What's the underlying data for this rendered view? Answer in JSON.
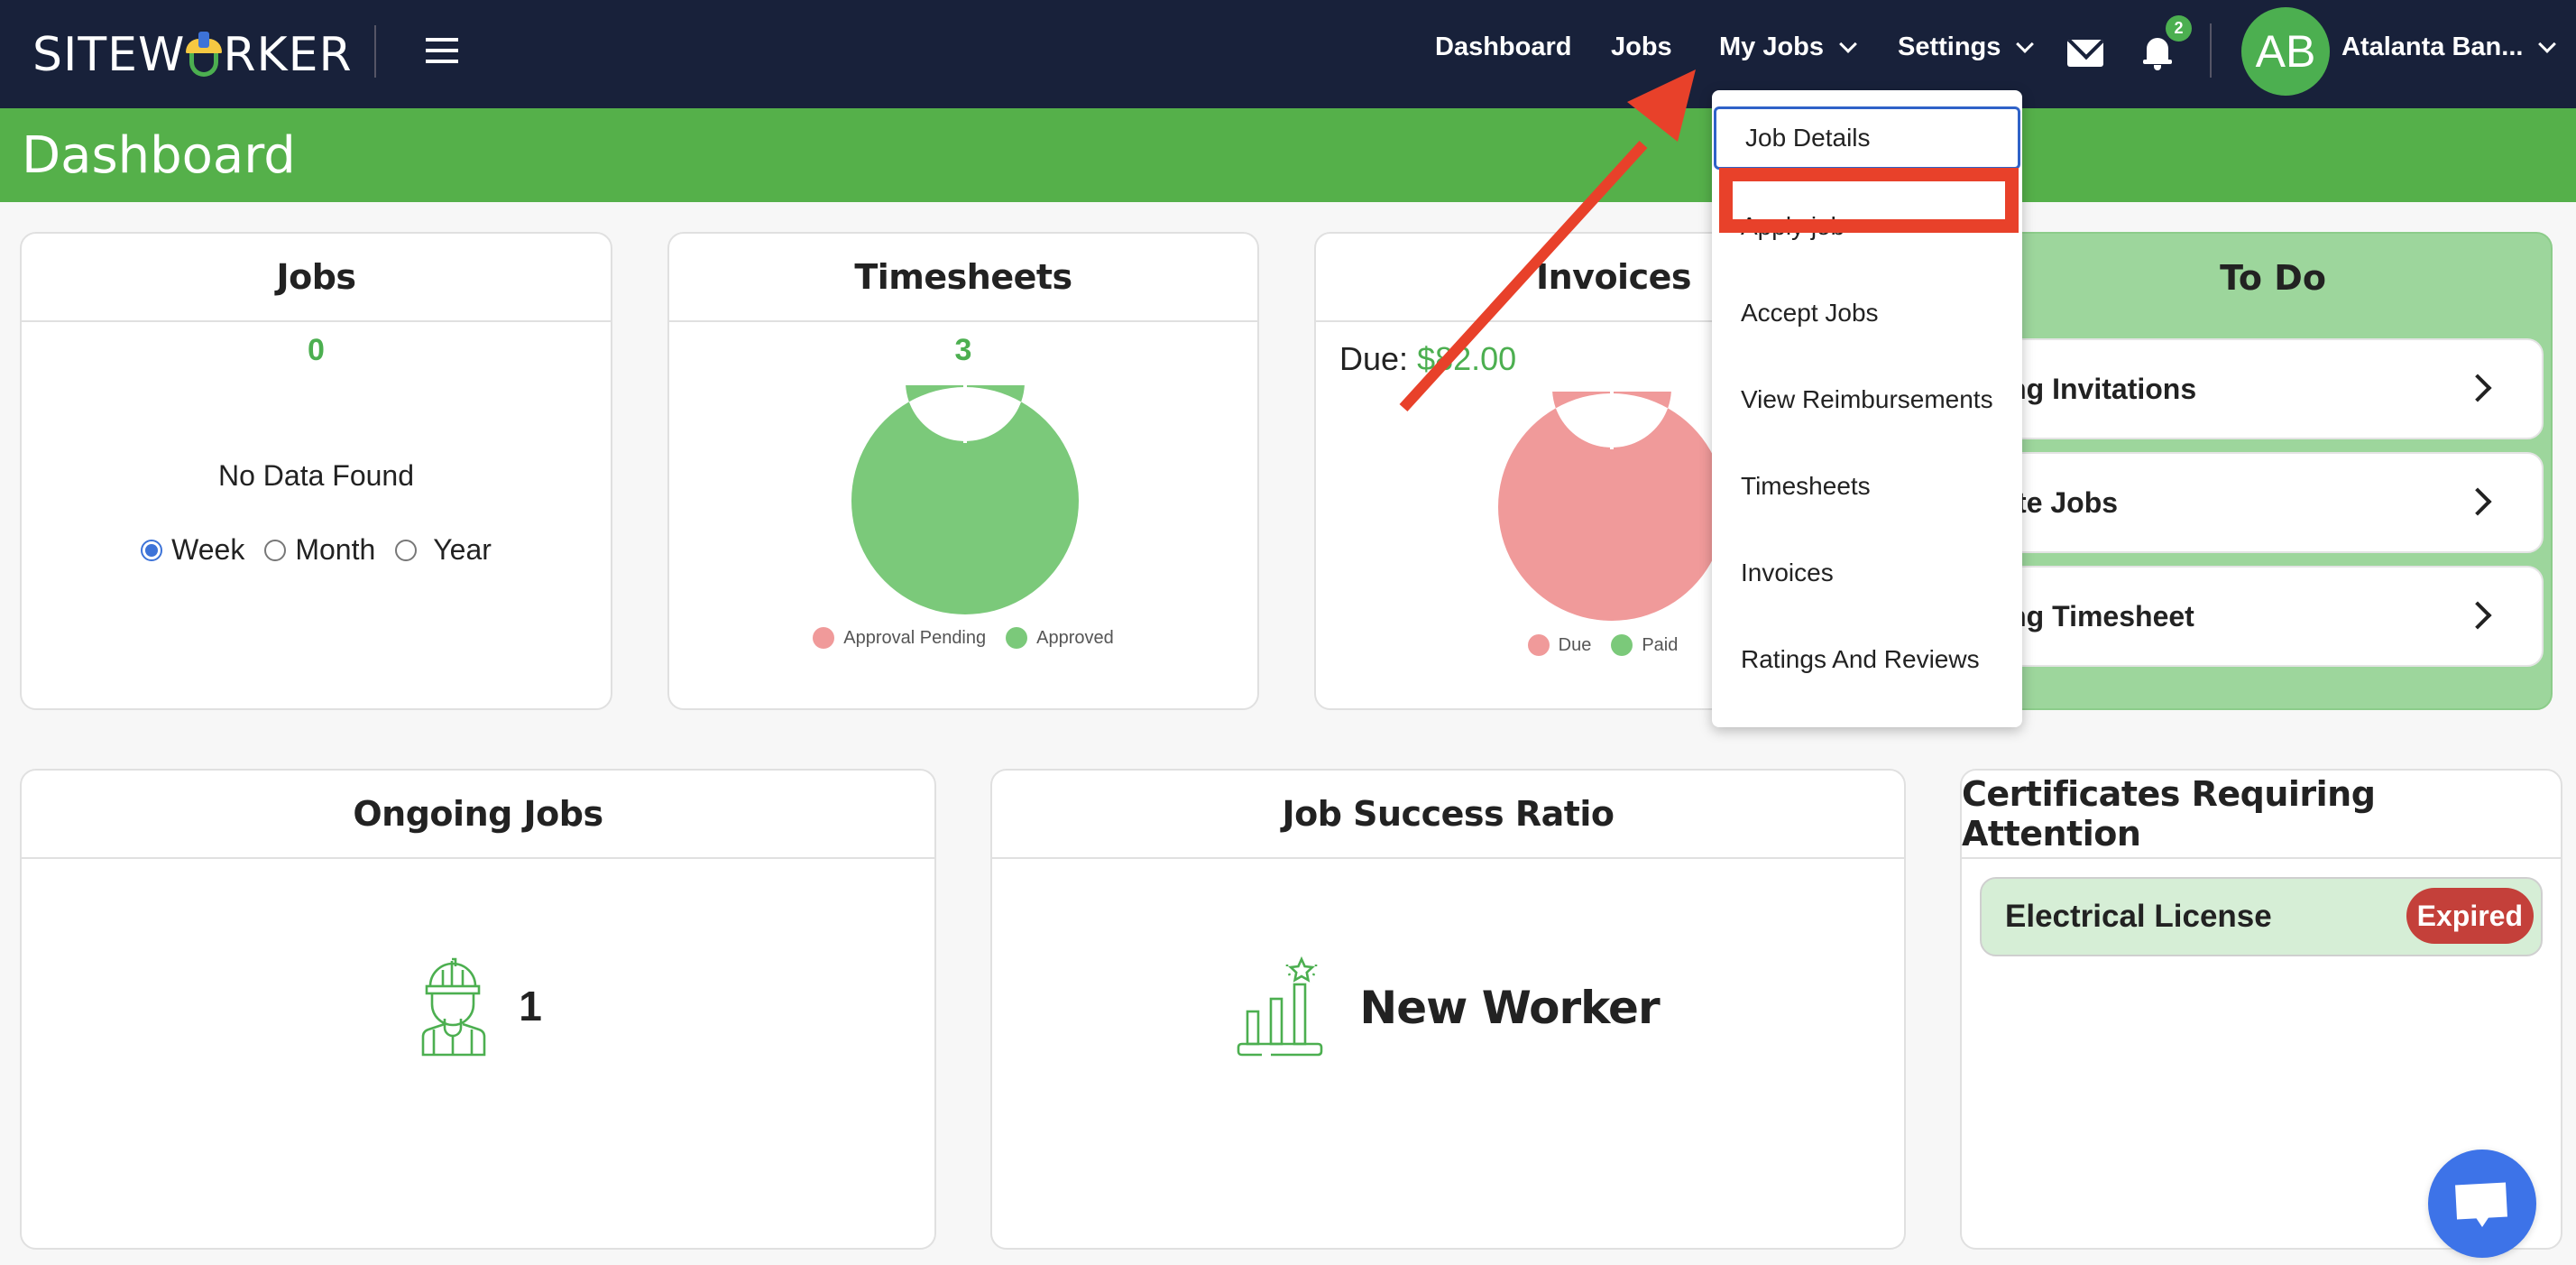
{
  "nav": {
    "logo_prefix": "SITEW",
    "logo_suffix": "RKER",
    "links": [
      {
        "label": "Dashboard"
      },
      {
        "label": "Jobs"
      },
      {
        "label": "My Jobs",
        "has_dropdown": true
      },
      {
        "label": "Settings",
        "has_dropdown": true
      }
    ],
    "notification_count": "2",
    "user_initials": "AB",
    "user_name": "Atalanta Ban..."
  },
  "page": {
    "title": "Dashboard"
  },
  "my_jobs_menu": {
    "items": [
      {
        "label": "Job Details",
        "focused": true
      },
      {
        "label": "Apply job",
        "highlighted": true
      },
      {
        "label": "Accept Jobs"
      },
      {
        "label": "View Reimbursements"
      },
      {
        "label": "Timesheets"
      },
      {
        "label": "Invoices"
      },
      {
        "label": "Ratings And Reviews"
      }
    ]
  },
  "jobs_card": {
    "title": "Jobs",
    "count": "0",
    "empty_text": "No Data Found",
    "range_options": [
      "Week",
      "Month",
      "Year"
    ],
    "selected_range": "Week"
  },
  "timesheets_card": {
    "title": "Timesheets",
    "count": "3"
  },
  "invoices_card": {
    "title": "Invoices",
    "due_label": "Due:",
    "due_amount": "$82.00"
  },
  "todo": {
    "title": "To Do",
    "items": [
      {
        "label": "Pending Invitations"
      },
      {
        "label": "Favorite Jobs"
      },
      {
        "label": "Pending Timesheet"
      }
    ]
  },
  "ongoing_jobs": {
    "title": "Ongoing Jobs",
    "count": "1"
  },
  "job_success": {
    "title": "Job Success Ratio",
    "status": "New Worker"
  },
  "certificates": {
    "title": "Certificates Requiring Attention",
    "items": [
      {
        "name": "Electrical License",
        "status": "Expired"
      }
    ]
  },
  "colors": {
    "nav_bg": "#18213a",
    "brand_green": "#55b04a",
    "accent_green": "#4caf50",
    "due_pink": "#f09a9a",
    "approved_green": "#7bc97a",
    "expired_red": "#c4403a",
    "annotation_red": "#e8412a"
  },
  "chart_data": [
    {
      "type": "pie",
      "title": "Timesheets",
      "categories": [
        "Approval Pending",
        "Approved"
      ],
      "values": [
        0,
        3
      ],
      "colors": [
        "#f09a9a",
        "#7bc97a"
      ],
      "legend": "bottom"
    },
    {
      "type": "pie",
      "title": "Invoices",
      "categories": [
        "Due",
        "Paid"
      ],
      "values": [
        82,
        0
      ],
      "colors": [
        "#f09a9a",
        "#7bc97a"
      ],
      "legend": "bottom"
    }
  ]
}
